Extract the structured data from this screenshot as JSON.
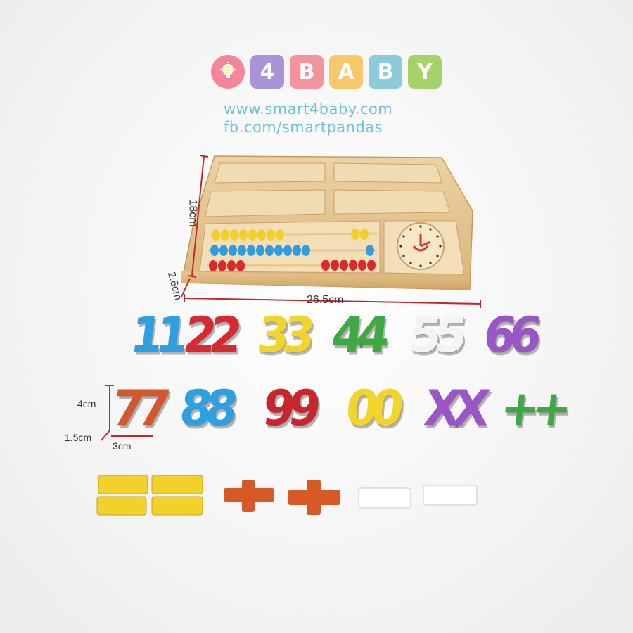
{
  "brand": {
    "logo_letters": [
      "4",
      "B",
      "A",
      "B",
      "Y"
    ],
    "tile_colors": [
      "#a894d6",
      "#f3939b",
      "#f5c86b",
      "#8ccbd8",
      "#a6d26a"
    ],
    "bulb_color": "#f4869a",
    "website": "www.smart4baby.com",
    "facebook": "fb.com/smartpandas"
  },
  "dimensions": {
    "height": "18cm",
    "depth": "2.6cm",
    "width": "26.5cm",
    "piece_height": "4cm",
    "piece_depth": "1.5cm",
    "piece_width": "3cm"
  },
  "digits_row1": [
    {
      "text": "11",
      "color": "#2e9fe0"
    },
    {
      "text": "22",
      "color": "#d8292f"
    },
    {
      "text": "33",
      "color": "#f2d52a"
    },
    {
      "text": "44",
      "color": "#3ea843"
    },
    {
      "text": "55",
      "color": "#f4f4f4"
    },
    {
      "text": "66",
      "color": "#9a56c7"
    }
  ],
  "digits_row2": [
    {
      "text": "77",
      "color": "#d2572a"
    },
    {
      "text": "88",
      "color": "#2e9fe0"
    },
    {
      "text": "99",
      "color": "#c8262d"
    },
    {
      "text": "00",
      "color": "#f2d52a"
    },
    {
      "text": "XX",
      "color": "#9a56c7"
    },
    {
      "text": "++",
      "color": "#3ea843"
    }
  ]
}
